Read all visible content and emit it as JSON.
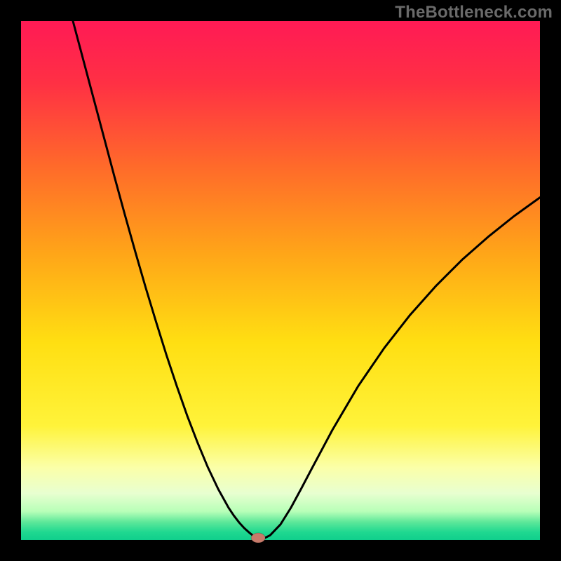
{
  "watermark": "TheBottleneck.com",
  "colors": {
    "frame": "#000000",
    "curve": "#000000",
    "marker_fill": "#c77a6a",
    "marker_stroke": "rgba(0,0,0,0.2)"
  },
  "chart_data": {
    "type": "line",
    "title": "",
    "xlabel": "",
    "ylabel": "",
    "xlim": [
      0,
      100
    ],
    "ylim": [
      0,
      100
    ],
    "gradient_stops": [
      {
        "offset": 0.0,
        "color": "#ff1a55"
      },
      {
        "offset": 0.12,
        "color": "#ff3044"
      },
      {
        "offset": 0.28,
        "color": "#ff6a2a"
      },
      {
        "offset": 0.45,
        "color": "#ffa618"
      },
      {
        "offset": 0.62,
        "color": "#ffdf12"
      },
      {
        "offset": 0.78,
        "color": "#fff33a"
      },
      {
        "offset": 0.86,
        "color": "#fbffa8"
      },
      {
        "offset": 0.91,
        "color": "#e8ffd0"
      },
      {
        "offset": 0.945,
        "color": "#b8ffb8"
      },
      {
        "offset": 0.965,
        "color": "#5fe89a"
      },
      {
        "offset": 0.985,
        "color": "#1fd890"
      },
      {
        "offset": 1.0,
        "color": "#10cf8c"
      }
    ],
    "series": [
      {
        "name": "bottleneck-curve",
        "x": [
          10.0,
          12,
          14,
          16,
          18,
          20,
          22,
          24,
          26,
          28,
          30,
          32,
          34,
          36,
          38,
          40,
          41,
          42,
          43,
          44,
          44.5,
          45,
          45.5,
          46,
          47,
          48,
          50,
          52,
          54,
          56,
          60,
          65,
          70,
          75,
          80,
          85,
          90,
          95,
          100
        ],
        "y": [
          100.0,
          92.5,
          85.0,
          77.5,
          70.0,
          62.7,
          55.6,
          48.7,
          42.1,
          35.7,
          29.7,
          24.0,
          18.8,
          14.0,
          9.8,
          6.2,
          4.7,
          3.4,
          2.3,
          1.4,
          1.0,
          0.6,
          0.4,
          0.4,
          0.4,
          0.9,
          3.0,
          6.2,
          9.9,
          13.7,
          21.2,
          29.7,
          37.0,
          43.4,
          49.0,
          54.0,
          58.4,
          62.4,
          66.0
        ]
      }
    ],
    "marker": {
      "x": 45.7,
      "y": 0.4
    },
    "annotations": []
  }
}
